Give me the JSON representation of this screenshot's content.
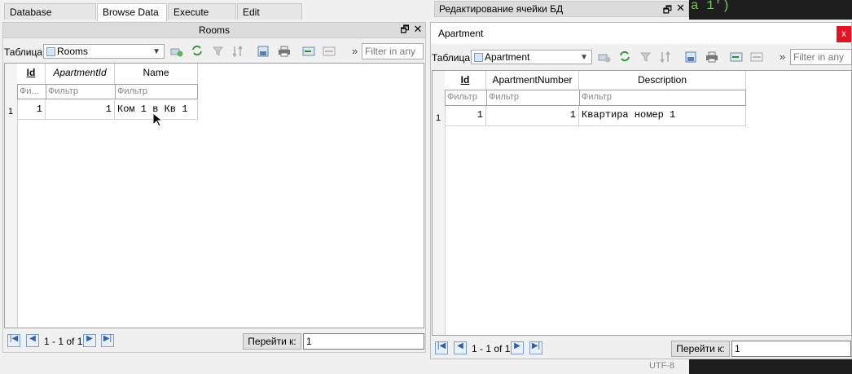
{
  "tabs": [
    {
      "label": "Database Structure"
    },
    {
      "label": "Browse Data"
    },
    {
      "label": "Execute SQL"
    },
    {
      "label": "Edit Pragmas"
    }
  ],
  "left_panel": {
    "title": "Rooms",
    "table_label": "Таблица:",
    "table_selected": "Rooms",
    "filter_placeholder": "Filter in any ...",
    "columns": [
      "Id",
      "ApartmentId",
      "Name"
    ],
    "filters": [
      "Фи...",
      "Фильтр",
      "Фильтр"
    ],
    "rows": [
      {
        "num": "1",
        "cells": [
          "1",
          "1",
          "Ком 1 в Кв 1"
        ]
      }
    ],
    "status": "1 - 1 of 1",
    "goto_label": "Перейти к:",
    "goto_value": "1"
  },
  "edit_cell_dock": {
    "title": "Редактирование ячейки БД"
  },
  "editor_snippet": "a 1')",
  "right_window": {
    "title": "Apartment",
    "close": "x",
    "table_label": "Таблица:",
    "table_selected": "Apartment",
    "filter_placeholder": "Filter in any",
    "columns": [
      "Id",
      "ApartmentNumber",
      "Description"
    ],
    "filters": [
      "Фильтр",
      "Фильтр",
      "Фильтр"
    ],
    "rows": [
      {
        "num": "1",
        "cells": [
          "1",
          "1",
          "Квартира номер 1"
        ]
      }
    ],
    "status": "1 - 1 of 1",
    "goto_label": "Перейти к:",
    "goto_value": "1"
  },
  "status_bar": {
    "encoding": "UTF-8"
  }
}
